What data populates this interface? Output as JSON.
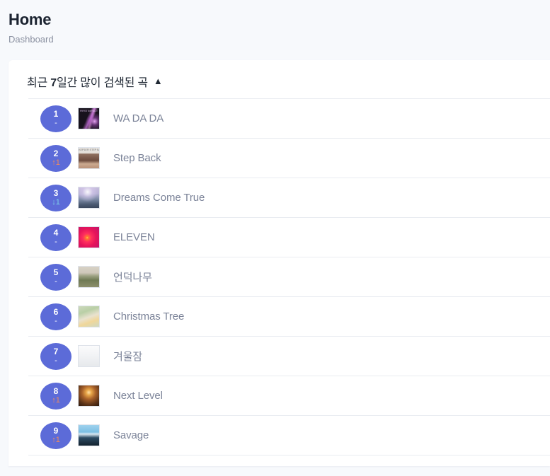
{
  "header": {
    "title": "Home",
    "subtitle": "Dashboard"
  },
  "card": {
    "title_prefix": "최근 ",
    "title_number": "7",
    "title_suffix": "일간 많이 검색된 곡",
    "collapse_icon": "▲",
    "collapse_icon_name": "triangle-up-icon"
  },
  "rows": [
    {
      "rank": "1",
      "delta": "-",
      "delta_dir": "same",
      "title": "WA DA DA",
      "art_class": "art-firstimpact",
      "art_label": "FIRST IMPACT"
    },
    {
      "rank": "2",
      "delta": "↑1",
      "delta_dir": "up",
      "title": "Step Back",
      "art_class": "art-group",
      "art_label": "KEP1ER  STEP BACK"
    },
    {
      "rank": "3",
      "delta": "↓1",
      "delta_dir": "down",
      "title": "Dreams Come True",
      "art_class": "art-dreams",
      "art_label": ""
    },
    {
      "rank": "4",
      "delta": "-",
      "delta_dir": "same",
      "title": "ELEVEN",
      "art_class": "art-eleven",
      "art_label": ""
    },
    {
      "rank": "5",
      "delta": "-",
      "delta_dir": "same",
      "title": "언덕나무",
      "art_class": "art-hill",
      "art_label": ""
    },
    {
      "rank": "6",
      "delta": "-",
      "delta_dir": "same",
      "title": "Christmas Tree",
      "art_class": "art-xmas",
      "art_label": ""
    },
    {
      "rank": "7",
      "delta": "-",
      "delta_dir": "same",
      "title": "겨울잠",
      "art_class": "art-winter",
      "art_label": ""
    },
    {
      "rank": "8",
      "delta": "↑1",
      "delta_dir": "up",
      "title": "Next Level",
      "art_class": "art-nextlevel",
      "art_label": ""
    },
    {
      "rank": "9",
      "delta": "↑1",
      "delta_dir": "up",
      "title": "Savage",
      "art_class": "art-savage",
      "art_label": ""
    }
  ],
  "colors": {
    "badge": "#5c6bd8",
    "delta_up": "#f08a5d",
    "delta_down": "#7fd4e8",
    "song_title": "#7b8398",
    "page_bg": "#f7f9fc",
    "card_bg": "#ffffff"
  }
}
